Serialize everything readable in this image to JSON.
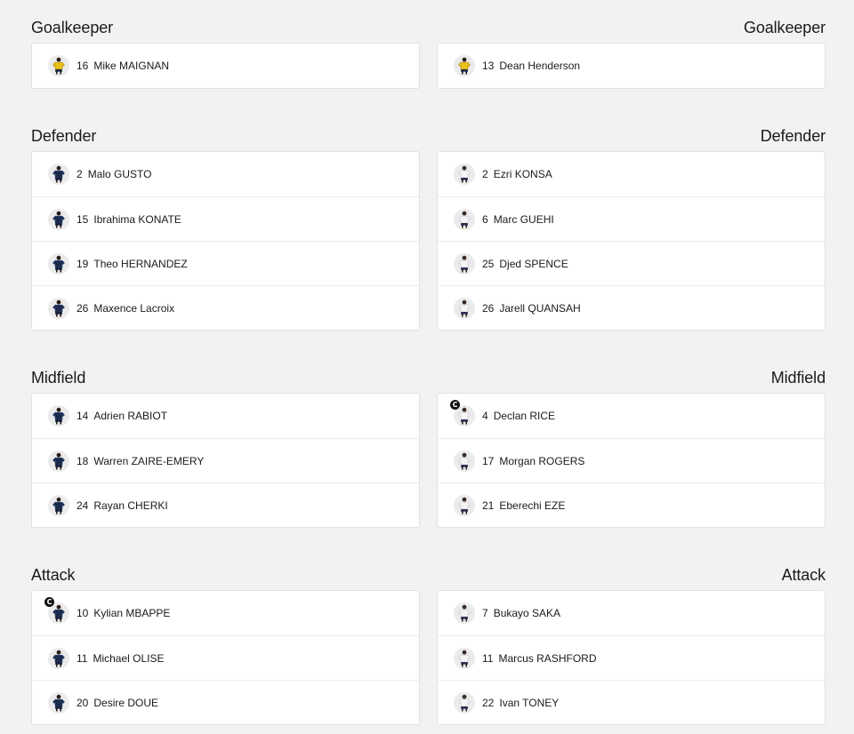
{
  "sections": [
    {
      "title": "Goalkeeper",
      "left": [
        {
          "number": "16",
          "name": "Mike MAIGNAN",
          "kit": "gk-yellow",
          "captain": false
        }
      ],
      "right": [
        {
          "number": "13",
          "name": "Dean Henderson",
          "kit": "gk-yellow",
          "captain": false
        }
      ]
    },
    {
      "title": "Defender",
      "left": [
        {
          "number": "2",
          "name": "Malo GUSTO",
          "kit": "navy",
          "captain": false
        },
        {
          "number": "15",
          "name": "Ibrahima KONATE",
          "kit": "navy",
          "captain": false
        },
        {
          "number": "19",
          "name": "Theo HERNANDEZ",
          "kit": "navy",
          "captain": false
        },
        {
          "number": "26",
          "name": "Maxence Lacroix",
          "kit": "navy",
          "captain": false
        }
      ],
      "right": [
        {
          "number": "2",
          "name": "Ezri KONSA",
          "kit": "white",
          "captain": false
        },
        {
          "number": "6",
          "name": "Marc GUEHI",
          "kit": "white",
          "captain": false
        },
        {
          "number": "25",
          "name": "Djed SPENCE",
          "kit": "white",
          "captain": false
        },
        {
          "number": "26",
          "name": "Jarell QUANSAH",
          "kit": "white",
          "captain": false
        }
      ]
    },
    {
      "title": "Midfield",
      "left": [
        {
          "number": "14",
          "name": "Adrien RABIOT",
          "kit": "navy",
          "captain": false
        },
        {
          "number": "18",
          "name": "Warren ZAIRE-EMERY",
          "kit": "navy",
          "captain": false
        },
        {
          "number": "24",
          "name": "Rayan CHERKI",
          "kit": "navy",
          "captain": false
        }
      ],
      "right": [
        {
          "number": "4",
          "name": "Declan RICE",
          "kit": "white",
          "captain": true
        },
        {
          "number": "17",
          "name": "Morgan ROGERS",
          "kit": "white",
          "captain": false
        },
        {
          "number": "21",
          "name": "Eberechi EZE",
          "kit": "white",
          "captain": false
        }
      ]
    },
    {
      "title": "Attack",
      "left": [
        {
          "number": "10",
          "name": "Kylian MBAPPE",
          "kit": "navy",
          "captain": true
        },
        {
          "number": "11",
          "name": "Michael OLISE",
          "kit": "navy",
          "captain": false
        },
        {
          "number": "20",
          "name": "Desire DOUE",
          "kit": "navy",
          "captain": false
        }
      ],
      "right": [
        {
          "number": "7",
          "name": "Bukayo SAKA",
          "kit": "white",
          "captain": false
        },
        {
          "number": "11",
          "name": "Marcus RASHFORD",
          "kit": "white",
          "captain": false
        },
        {
          "number": "22",
          "name": "Ivan TONEY",
          "kit": "white",
          "captain": false
        }
      ]
    }
  ],
  "captain_label": "C",
  "kit_colors": {
    "gk-yellow": {
      "shirt": "#e8c21a",
      "trim": "#b8860b",
      "shorts": "#1f2a44"
    },
    "navy": {
      "shirt": "#1c2b4d",
      "trim": "#2f4a7a",
      "shorts": "#16203a"
    },
    "white": {
      "shirt": "#f4f4f4",
      "trim": "#c9c9d6",
      "shorts": "#2b2e4a"
    }
  }
}
